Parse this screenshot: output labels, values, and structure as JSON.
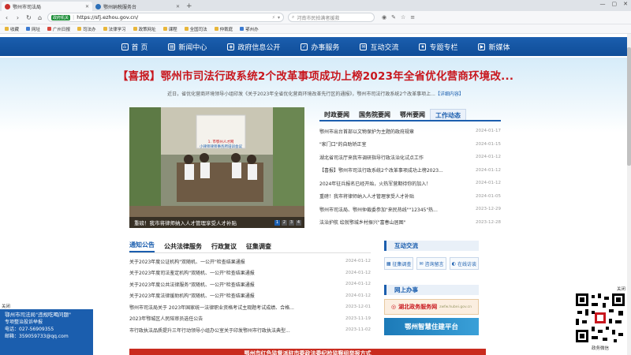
{
  "tabs": [
    {
      "label": "鄂州市司法局",
      "active": true
    },
    {
      "label": "鄂州纳税服务台",
      "active": false
    }
  ],
  "window_controls": [
    "—",
    "▢",
    "✕"
  ],
  "address": {
    "badge": "政府机关",
    "url": "https://sfj.ezhou.gov.cn/",
    "search_placeholder": "河南市民拍满者援救"
  },
  "bookmarks": [
    "收藏",
    "网址",
    "广州日报",
    "司法办",
    "法律学习",
    "政策网址",
    "课程",
    "全国司法",
    "仲裁庭",
    "鄂州办"
  ],
  "main_nav": [
    "首 页",
    "新闻中心",
    "政府信息公开",
    "办事服务",
    "互动交流",
    "专题专栏",
    "新媒体"
  ],
  "headline": "【喜报】鄂州市司法行政系统2个改革事项成功上榜2023年全省优化营商环境改...",
  "subhead": "近日，省优化营商环境领导小组印发《关于2023年全省优化营商环境改革先行区的通报》，鄂州市司法行政系统2个改革事项上...",
  "subhead_more": "【详细内容】",
  "photo": {
    "banner_text_1": "1. 市鄂州人才网",
    "banner_text_2": "小律师律师事务所培训会议",
    "caption": "重磅！我市将律师纳入人才管理享受人才补贴",
    "pages": [
      "1",
      "2",
      "3",
      "4"
    ]
  },
  "news": {
    "tabs": [
      "时政要闻",
      "国务院要闻",
      "鄂州要闻",
      "工作动态"
    ],
    "active_tab": 3,
    "items": [
      {
        "title": "鄂州市出台首部以文物保护为主题的政府规章",
        "date": "2024-01-17"
      },
      {
        "title": "\"家门口\"的自助矫正室",
        "date": "2024-01-15"
      },
      {
        "title": "湖北省司法厅来我市调研指导行政法治化试点工作",
        "date": "2024-01-12"
      },
      {
        "title": "【喜报】鄂州市司法行政系统2个改革事项成功上榜2023...",
        "date": "2024-01-12"
      },
      {
        "title": "2024年征兵报名已经开始，火热军营期待你的加入！",
        "date": "2024-01-12"
      },
      {
        "title": "重磅！我市将律师纳入人才管理享受人才补贴",
        "date": "2024-01-05"
      },
      {
        "title": "鄂州市司法局、鄂州仲裁委参加\"来民热线\"\"12345\"热...",
        "date": "2023-12-29"
      },
      {
        "title": "法治护航 绘就鄂城乡村振兴\"富春山居图\"",
        "date": "2023-12-28"
      }
    ]
  },
  "notices": {
    "tabs": [
      "通知公告",
      "公共法律服务",
      "行政复议",
      "征集调查"
    ],
    "active_tab": 0,
    "items": [
      {
        "title": "关于2023年度公证机构\"双随机、一公开\"检查结果通报",
        "date": "2024-01-12"
      },
      {
        "title": "关于2023年度司法鉴定机构\"双随机、一公开\"检查结果通报",
        "date": "2024-01-12"
      },
      {
        "title": "关于2023年度公共法律服务\"双随机、一公开\"检查结果通报",
        "date": "2024-01-12"
      },
      {
        "title": "关于2023年度法律援助机构\"双随机、一公开\"检查结果通报",
        "date": "2024-01-12"
      },
      {
        "title": "鄂州市司法局关于 2023年国家统一法律职业资格考试主观题考试成绩、合格...",
        "date": "2023-12-01"
      },
      {
        "title": "2023年鄂城区人民陪审员选任公告",
        "date": "2023-11-19"
      },
      {
        "title": "市行政执法品质提升三年行动领导小组办公室关于印发鄂州市行政执法典型...",
        "date": "2023-11-02"
      }
    ]
  },
  "interact": {
    "title": "互动交流",
    "buttons": [
      "征集调查",
      "咨询留言",
      "在线访谈"
    ]
  },
  "online": {
    "title": "网上办事",
    "gov_service": "湖北政务服务网",
    "gov_service_sub": "zwfw.hubei.gov.cn",
    "smart": "鄂州智慧住建平台"
  },
  "floatbox": {
    "close": "关闭",
    "title": "鄂州市司法局\"违规吃喝问题\"",
    "subtitle": "专项整治投诉举报",
    "phone": "电话：027-56909355",
    "email": "邮箱：359059733@qq.com"
  },
  "qr": {
    "label": "政务微信",
    "close": "关闭"
  },
  "bottom_strip": "鄂州市红色监督派驻市委政法委纪检监察组举报方式",
  "colors": {
    "nav_blue": "#1b5eae",
    "headline_red": "#c8161d"
  }
}
